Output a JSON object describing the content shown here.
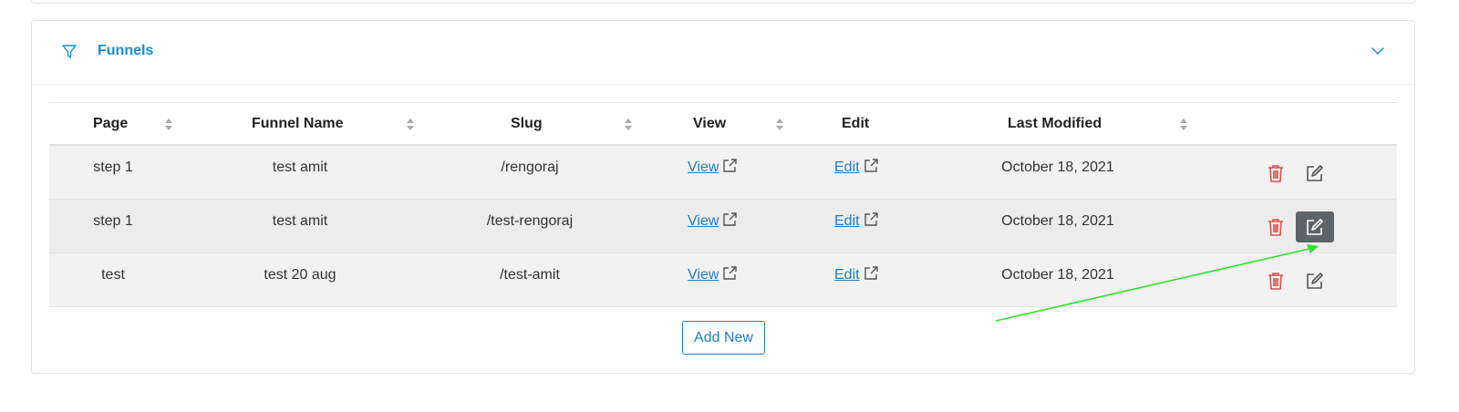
{
  "panel": {
    "title": "Funnels",
    "icons": {
      "filter": "filter-icon",
      "chevron": "chevron-down-icon"
    }
  },
  "table": {
    "headers": {
      "page": "Page",
      "funnel_name": "Funnel Name",
      "slug": "Slug",
      "view": "View",
      "edit": "Edit",
      "last_modified": "Last Modified"
    },
    "rows": [
      {
        "page": "step 1",
        "funnel_name": "test amit",
        "slug": "/rengoraj",
        "view": "View",
        "edit": "Edit",
        "last_modified": "October 18, 2021"
      },
      {
        "page": "step 1",
        "funnel_name": "test amit",
        "slug": "/test-rengoraj",
        "view": "View",
        "edit": "Edit",
        "last_modified": "October 18, 2021"
      },
      {
        "page": "test",
        "funnel_name": "test 20 aug",
        "slug": "/test-amit",
        "view": "View",
        "edit": "Edit",
        "last_modified": "October 18, 2021"
      }
    ],
    "highlighted_row_index": 1
  },
  "add_new_label": "Add New",
  "colors": {
    "accent": "#1a8fd6",
    "link": "#1f7dc4",
    "delete": "#d9534f",
    "edit_active_bg": "#5f6266",
    "annotation_arrow": "#2ee02e"
  }
}
